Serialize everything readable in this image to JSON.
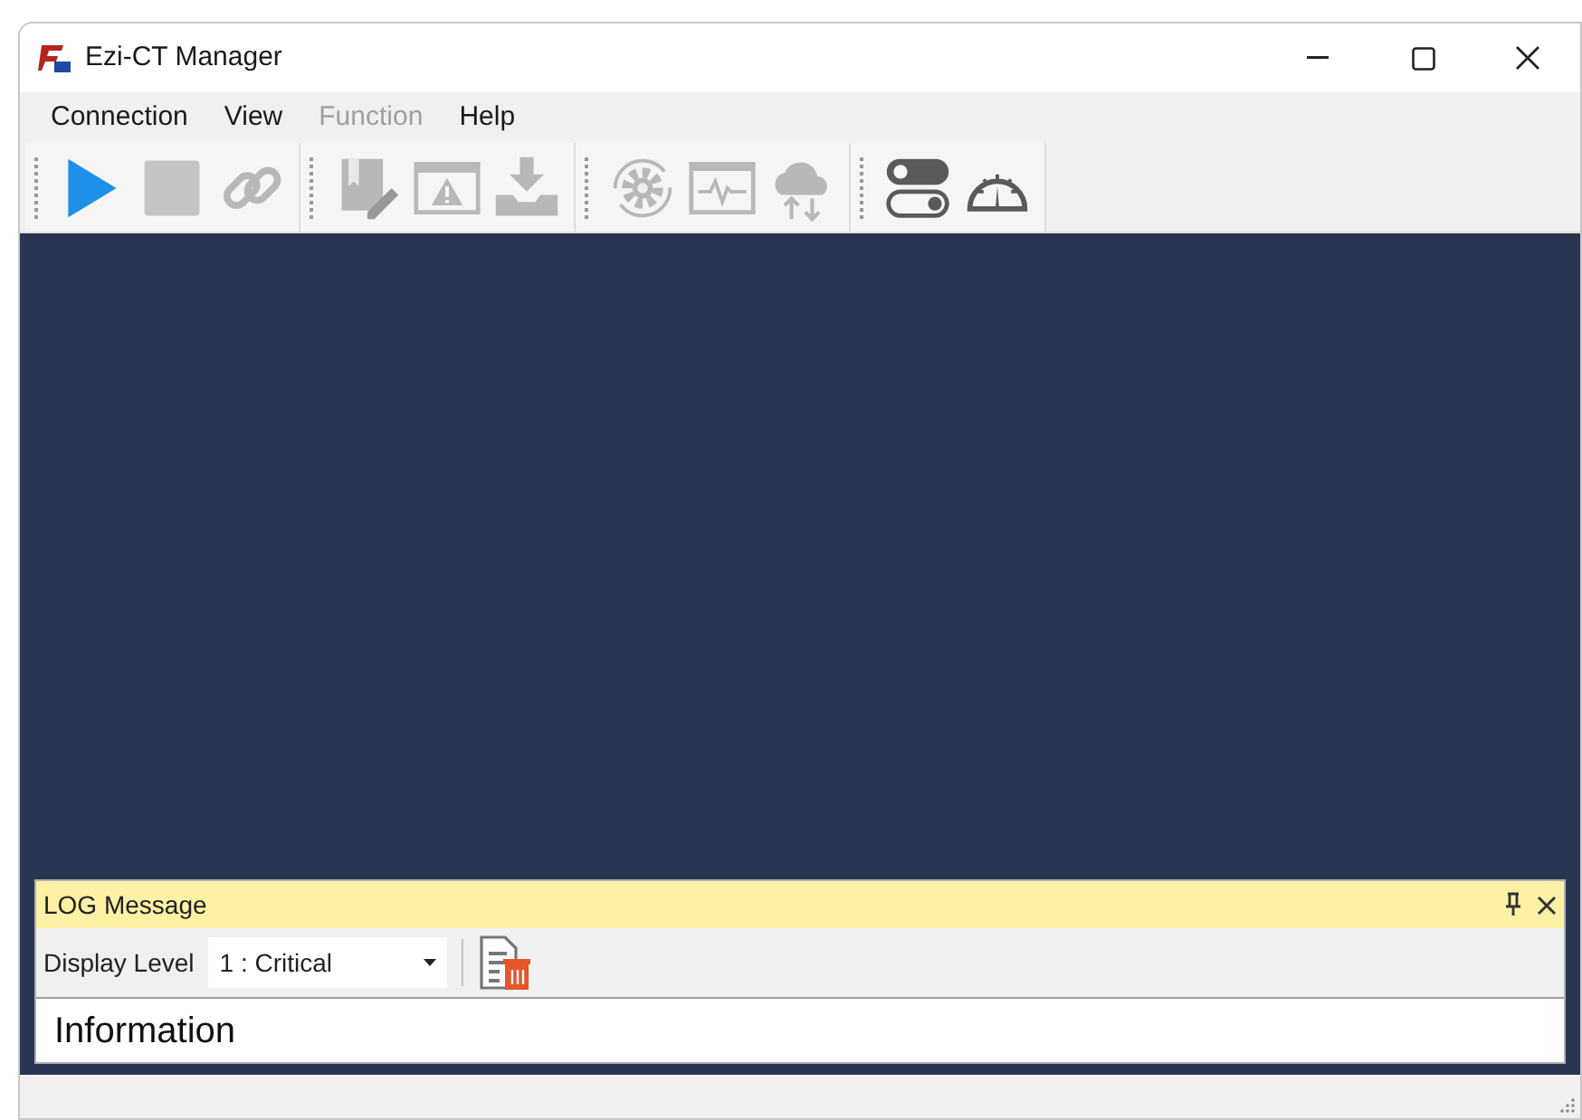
{
  "window": {
    "title": "Ezi-CT Manager"
  },
  "menu": [
    {
      "label": "Connection",
      "disabled": false
    },
    {
      "label": "View",
      "disabled": false
    },
    {
      "label": "Function",
      "disabled": true
    },
    {
      "label": "Help",
      "disabled": false
    }
  ],
  "toolbar": [
    [
      {
        "kind": "play",
        "disabled": false
      },
      {
        "kind": "stop",
        "disabled": true
      },
      {
        "kind": "link",
        "disabled": true
      }
    ],
    [
      {
        "kind": "edit",
        "disabled": true
      },
      {
        "kind": "warning",
        "disabled": true
      },
      {
        "kind": "download",
        "disabled": true
      }
    ],
    [
      {
        "kind": "gear",
        "disabled": true
      },
      {
        "kind": "pulse",
        "disabled": true
      },
      {
        "kind": "cloud",
        "disabled": true
      }
    ],
    [
      {
        "kind": "toggle",
        "disabled": false
      },
      {
        "kind": "gauge",
        "disabled": false
      }
    ]
  ],
  "log_panel": {
    "title": "LOG Message",
    "display_level_label": "Display Level",
    "display_level": "1 : Critical",
    "message": "Information"
  }
}
